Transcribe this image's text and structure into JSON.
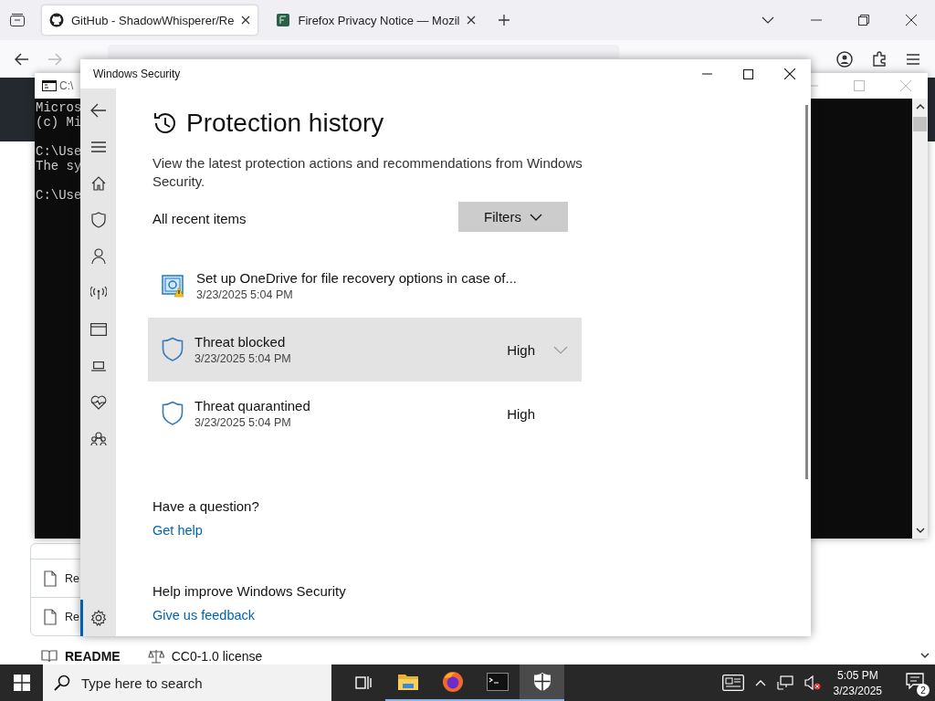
{
  "browser": {
    "tabs": [
      {
        "title": "GitHub - ShadowWhisperer/Re",
        "selected": true
      },
      {
        "title": "Firefox Privacy Notice — Mozil",
        "selected": false
      }
    ],
    "files": [
      "Re",
      "Re"
    ],
    "readme_tab": "README",
    "license_tab": "CC0-1.0 license"
  },
  "console": {
    "title": "C:\\",
    "blocks": [
      [
        "Micros",
        "(c) Mi"
      ],
      [
        "C:\\Use",
        "The sy"
      ],
      [
        "C:\\Use"
      ]
    ]
  },
  "security": {
    "title": "Windows Security",
    "nav": [
      {
        "kind": "back",
        "selected": false
      },
      {
        "kind": "menu",
        "selected": false
      },
      {
        "kind": "home",
        "selected": false
      },
      {
        "kind": "shield",
        "selected": false
      },
      {
        "kind": "person",
        "selected": false
      },
      {
        "kind": "wireless",
        "selected": false
      },
      {
        "kind": "browser",
        "selected": false
      },
      {
        "kind": "laptop",
        "selected": false
      },
      {
        "kind": "heart",
        "selected": false
      },
      {
        "kind": "family",
        "selected": false
      },
      {
        "kind": "settings",
        "selected": true
      }
    ],
    "heading": "Protection history",
    "description": "View the latest protection actions and recommendations from Windows Security.",
    "list_label": "All recent items",
    "filters": "Filters",
    "items": [
      {
        "kind": "onedrive",
        "title": "Set up OneDrive for file recovery options in case of...",
        "time": "3/23/2025 5:04 PM",
        "highlighted": false
      },
      {
        "kind": "threat",
        "title": "Threat blocked",
        "time": "3/23/2025 5:04 PM",
        "severity": "High",
        "highlighted": true
      },
      {
        "kind": "threat",
        "title": "Threat quarantined",
        "time": "3/23/2025 5:04 PM",
        "severity": "High",
        "highlighted": false
      }
    ],
    "question": "Have a question?",
    "help_link": "Get help",
    "improve": "Help improve Windows Security",
    "feedback_link": "Give us feedback"
  },
  "taskbar": {
    "search_placeholder": "Type here to search",
    "apps": [
      {
        "kind": "taskview",
        "open": false,
        "selected": false
      },
      {
        "kind": "explorer",
        "open": true,
        "selected": false
      },
      {
        "kind": "firefox",
        "open": true,
        "selected": false
      },
      {
        "kind": "terminal",
        "open": true,
        "selected": false
      },
      {
        "kind": "security",
        "open": true,
        "selected": true
      }
    ],
    "time": "5:05 PM",
    "date": "3/23/2025",
    "notifications": "2"
  }
}
